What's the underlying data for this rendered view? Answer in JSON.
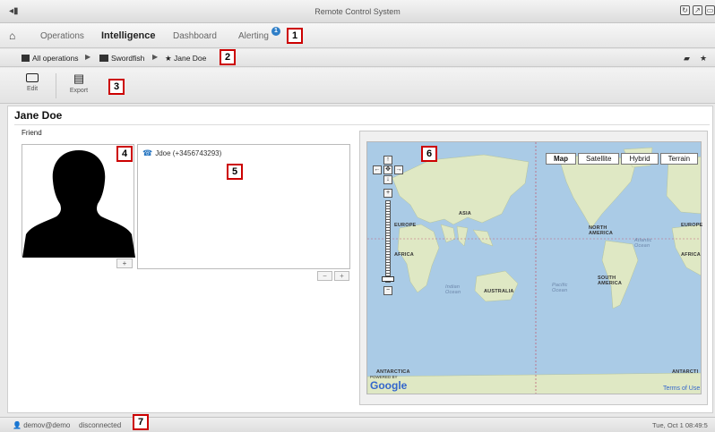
{
  "window": {
    "title": "Remote Control System",
    "controls": [
      "refresh-icon",
      "maximize-icon",
      "close-icon"
    ]
  },
  "nav": {
    "home_icon": "home-icon",
    "items": [
      {
        "label": "Operations",
        "active": false
      },
      {
        "label": "Intelligence",
        "active": true
      },
      {
        "label": "Dashboard",
        "active": false
      },
      {
        "label": "Alerting",
        "active": false,
        "badge": "1"
      }
    ]
  },
  "breadcrumb": {
    "items": [
      {
        "label": "All operations",
        "icon": "operation-icon"
      },
      {
        "label": "Swordfish",
        "icon": "target-group-icon"
      },
      {
        "label": "Jane Doe",
        "icon": "star-icon"
      }
    ],
    "right_icons": [
      "group-icon",
      "star-icon"
    ]
  },
  "toolbar": {
    "edit_label": "Edit",
    "export_label": "Export"
  },
  "entity": {
    "name": "Jane Doe",
    "type": "Friend"
  },
  "contacts": [
    {
      "label": "Jdoe (+3456743293)",
      "icon": "phone-icon"
    }
  ],
  "map": {
    "types": [
      "Map",
      "Satellite",
      "Hybrid",
      "Terrain"
    ],
    "selected_type": "Map",
    "labels": {
      "asia": "ASIA",
      "europe": "EUROPE",
      "europe2": "EUROPE",
      "africa": "AFRICA",
      "africa2": "AFRICA",
      "australia": "AUSTRALIA",
      "north_america": "NORTH AMERICA",
      "south_america": "SOUTH AMERICA",
      "antarctica": "ANTARCTICA",
      "antarctica2": "ANTARCTI",
      "indian_ocean": "Indian Ocean",
      "pacific_ocean": "Pacific Ocean",
      "atlantic_ocean": "Atlantic Ocean"
    },
    "powered_by": "POWERED BY",
    "google": "Google",
    "terms": "Terms of Use"
  },
  "status": {
    "user": "demov@demo",
    "connection": "disconnected",
    "datetime": "Tue, Oct 1  08:49:5"
  },
  "callouts": [
    "1",
    "2",
    "3",
    "4",
    "5",
    "6",
    "7"
  ],
  "colors": {
    "callout_border": "#cc0000",
    "badge": "#2f7fc8",
    "ocean": "#aacbe6",
    "land": "#dfe8c4",
    "link": "#3366cc"
  }
}
